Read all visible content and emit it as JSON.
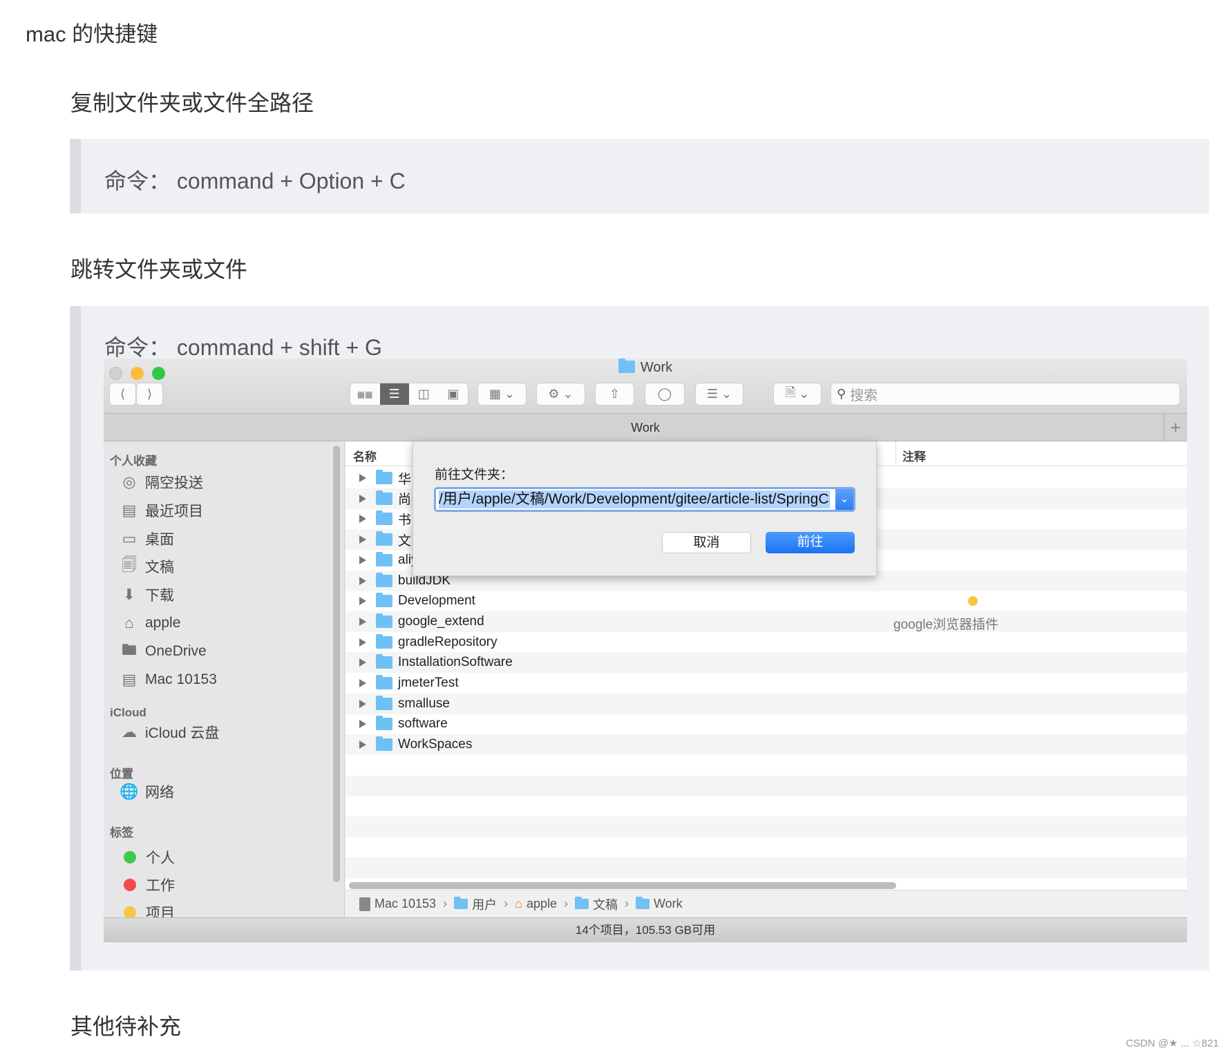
{
  "doc": {
    "title": "mac 的快捷键",
    "section1": {
      "heading": "复制文件夹或文件全路径",
      "command": "命令：  command + Option + C"
    },
    "section2": {
      "heading": "跳转文件夹或文件",
      "command": "命令：  command + shift + G"
    },
    "section3": {
      "heading": "其他待补充"
    },
    "watermark": "CSDN @★ ... ☆821"
  },
  "finder": {
    "window_title": "Work",
    "path_tab": "Work",
    "search_placeholder": "搜索",
    "sidebar": {
      "favorites_header": "个人收藏",
      "favorites": [
        {
          "label": "隔空投送",
          "icon": "airdrop-icon"
        },
        {
          "label": "最近项目",
          "icon": "recents-icon"
        },
        {
          "label": "桌面",
          "icon": "desktop-icon"
        },
        {
          "label": "文稿",
          "icon": "documents-icon"
        },
        {
          "label": "下载",
          "icon": "download-icon"
        },
        {
          "label": "apple",
          "icon": "home-icon"
        },
        {
          "label": "OneDrive",
          "icon": "folder-icon"
        },
        {
          "label": "Mac 10153",
          "icon": "harddisk-icon"
        }
      ],
      "icloud_header": "iCloud",
      "icloud": [
        {
          "label": "iCloud 云盘",
          "icon": "cloud-icon"
        }
      ],
      "locations_header": "位置",
      "locations": [
        {
          "label": "网络",
          "icon": "network-icon"
        }
      ],
      "tags_header": "标签",
      "tags": [
        {
          "label": "个人",
          "color": "#3fc94f"
        },
        {
          "label": "工作",
          "color": "#f34b4b"
        },
        {
          "label": "项目",
          "color": "#f8c73e"
        }
      ]
    },
    "columns": {
      "name": "名称",
      "comment": "注释"
    },
    "rows": [
      {
        "name": "华"
      },
      {
        "name": "尚"
      },
      {
        "name": "书"
      },
      {
        "name": "文"
      },
      {
        "name": "aliy"
      },
      {
        "name": "buildJDK"
      },
      {
        "name": "Development",
        "tag_color": "#f8c73e"
      },
      {
        "name": "google_extend",
        "comment": "google浏览器插件"
      },
      {
        "name": "gradleRepository"
      },
      {
        "name": "InstallationSoftware"
      },
      {
        "name": "jmeterTest"
      },
      {
        "name": "smalluse"
      },
      {
        "name": "software"
      },
      {
        "name": "WorkSpaces"
      }
    ],
    "breadcrumb": [
      "Mac 10153",
      "用户",
      "apple",
      "文稿",
      "Work"
    ],
    "status": "14个项目，105.53 GB可用",
    "dialog": {
      "label": "前往文件夹：",
      "path": "/用户/apple/文稿/Work/Development/gitee/article-list/SpringCloud",
      "cancel": "取消",
      "go": "前往"
    }
  }
}
